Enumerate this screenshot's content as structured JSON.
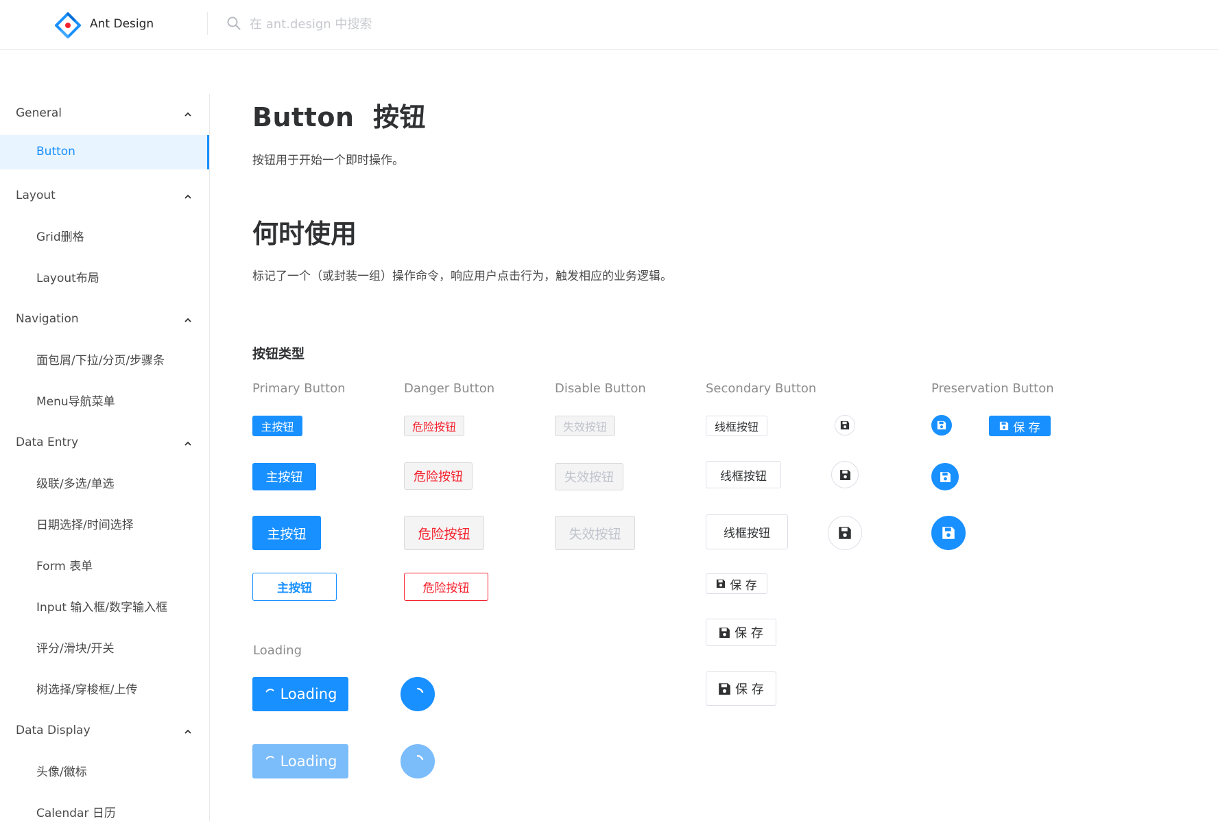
{
  "header": {
    "brand": "Ant Design",
    "search_placeholder": "在 ant.design 中搜索"
  },
  "sidebar": {
    "groups": [
      {
        "label": "General",
        "items": [
          "Button"
        ]
      },
      {
        "label": "Layout",
        "items": [
          "Grid删格",
          "Layout布局"
        ]
      },
      {
        "label": "Navigation",
        "items": [
          "面包屑/下拉/分页/步骤条",
          "Menu导航菜单"
        ]
      },
      {
        "label": "Data Entry",
        "items": [
          "级联/多选/单选",
          "日期选择/时间选择",
          "Form 表单",
          "Input 输入框/数字输入框",
          "评分/滑块/开关",
          "树选择/穿梭框/上传"
        ]
      },
      {
        "label": "Data Display",
        "items": [
          "头像/徽标",
          "Calendar 日历"
        ]
      }
    ],
    "active_item": "Button"
  },
  "main": {
    "title": "Button  按钮",
    "description": "按钮用于开始一个即时操作。",
    "when_title": "何时使用",
    "when_description": "标记了一个（或封装一组）操作命令，响应用户点击行为，触发相应的业务逻辑。",
    "section_title": "按钮类型",
    "columns": {
      "primary": "Primary Button",
      "danger": "Danger Button",
      "disable": "Disable Button",
      "secondary": "Secondary Button",
      "preservation": "Preservation Button"
    },
    "buttons": {
      "primary": "主按钮",
      "danger": "危险按钮",
      "disabled": "失效按钮",
      "outline": "线框按钮",
      "save": "保 存"
    },
    "loading_label": "Loading",
    "loading_button": "Loading"
  },
  "colors": {
    "primary": "#1890ff",
    "danger": "#f5222d",
    "active_bg": "#e8f4ff"
  }
}
